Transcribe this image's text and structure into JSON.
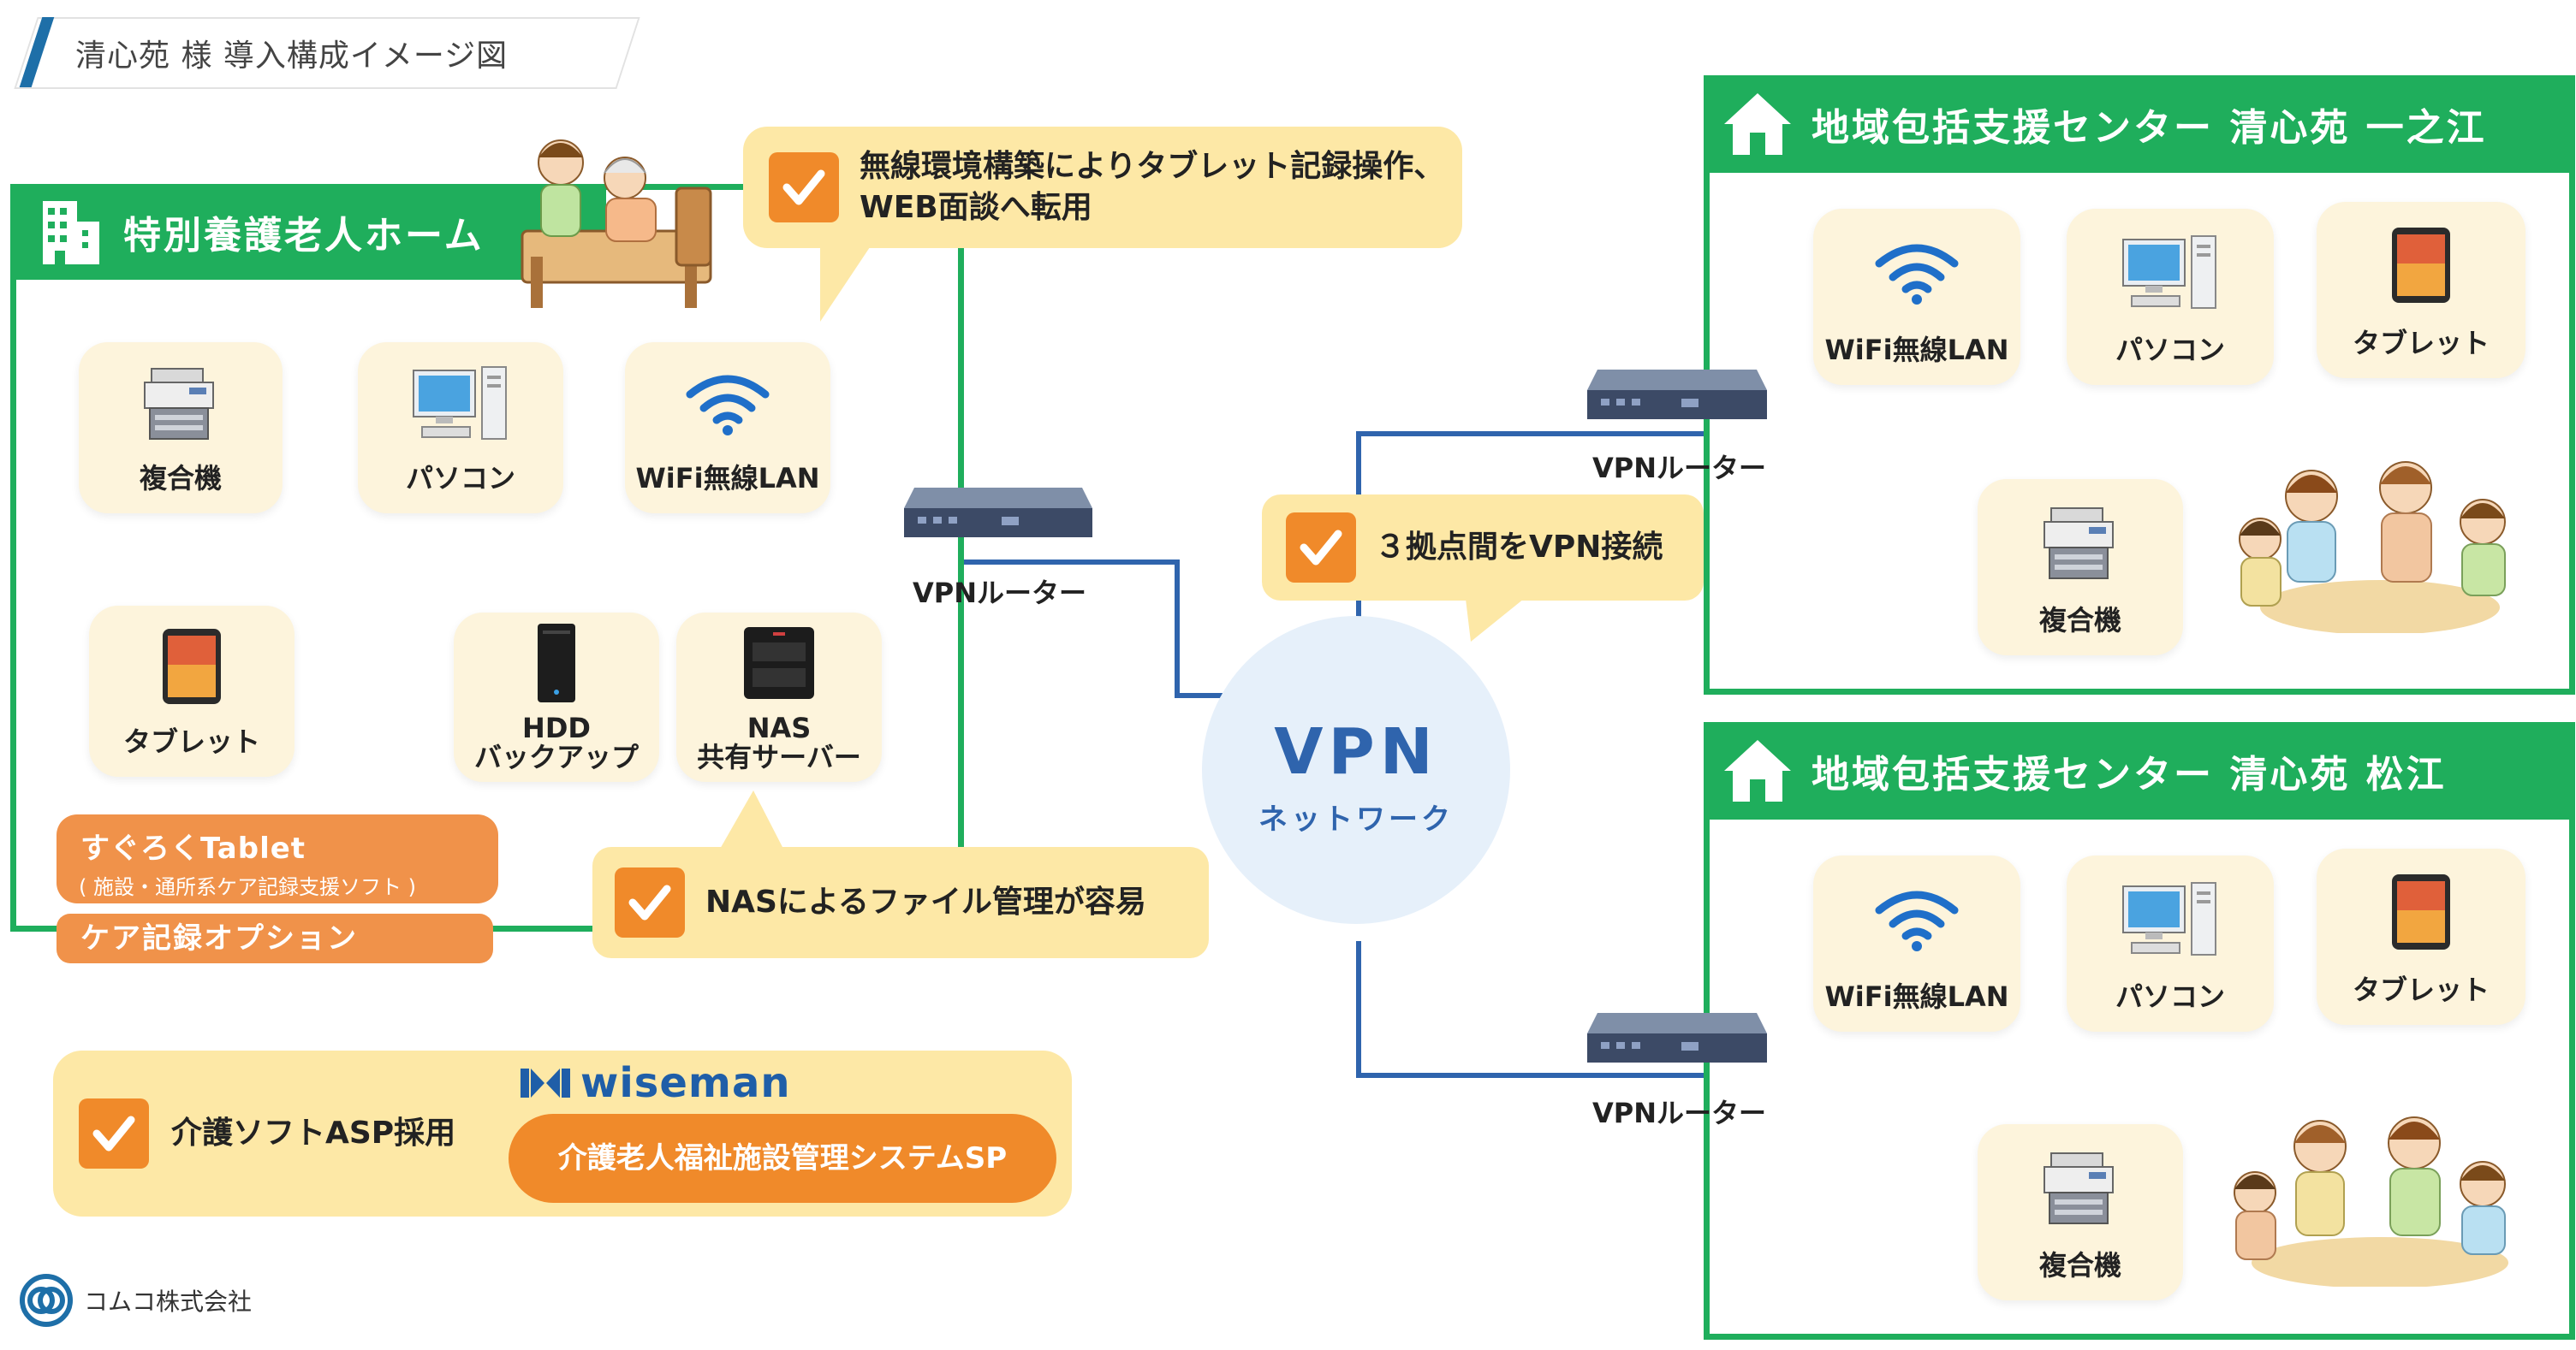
{
  "header": {
    "title": "清心苑 様 導入構成イメージ図"
  },
  "main_site": {
    "title": "特別養護老人ホーム",
    "devices": {
      "copier": "複合機",
      "pc": "パソコン",
      "wifi": "WiFi無線LAN",
      "tablet": "タブレット",
      "hdd": [
        "HDD",
        "バックアップ"
      ],
      "nas": [
        "NAS",
        "共有サーバー"
      ]
    },
    "router_label": "VPNルーター",
    "software": {
      "name": "すぐろくTablet",
      "sub": "( 施設・通所系ケア記録支援ソフト )",
      "option": "ケア記録オプション"
    }
  },
  "callouts": {
    "wireless": [
      "無線環境構築によりタブレット記録操作、",
      "WEB面談へ転用"
    ],
    "nas": "NASによるファイル管理が容易",
    "vpn": "３拠点間をVPN接続",
    "asp": "介護ソフトASP採用"
  },
  "vpn_cloud": {
    "title": "VPN",
    "subtitle": "ネットワーク"
  },
  "wiseman": {
    "brand": "wiseman",
    "product": "介護老人福祉施設管理システムSP"
  },
  "branch_sites": [
    {
      "title": "地域包括支援センター 清心苑 一之江",
      "devices": {
        "wifi": "WiFi無線LAN",
        "pc": "パソコン",
        "tablet": "タブレット",
        "copier": "複合機"
      },
      "router_label": "VPNルーター"
    },
    {
      "title": "地域包括支援センター 清心苑 松江",
      "devices": {
        "wifi": "WiFi無線LAN",
        "pc": "パソコン",
        "tablet": "タブレット",
        "copier": "複合機"
      },
      "router_label": "VPNルーター"
    }
  ],
  "company": {
    "name": "コムコ株式会社"
  },
  "colors": {
    "green": "#1fae5c",
    "orange": "#f08a2a",
    "cream": "#fdf4dc",
    "yellow": "#fde8a6",
    "line": "#2f64ad",
    "vpn": "#e6f0fa"
  }
}
